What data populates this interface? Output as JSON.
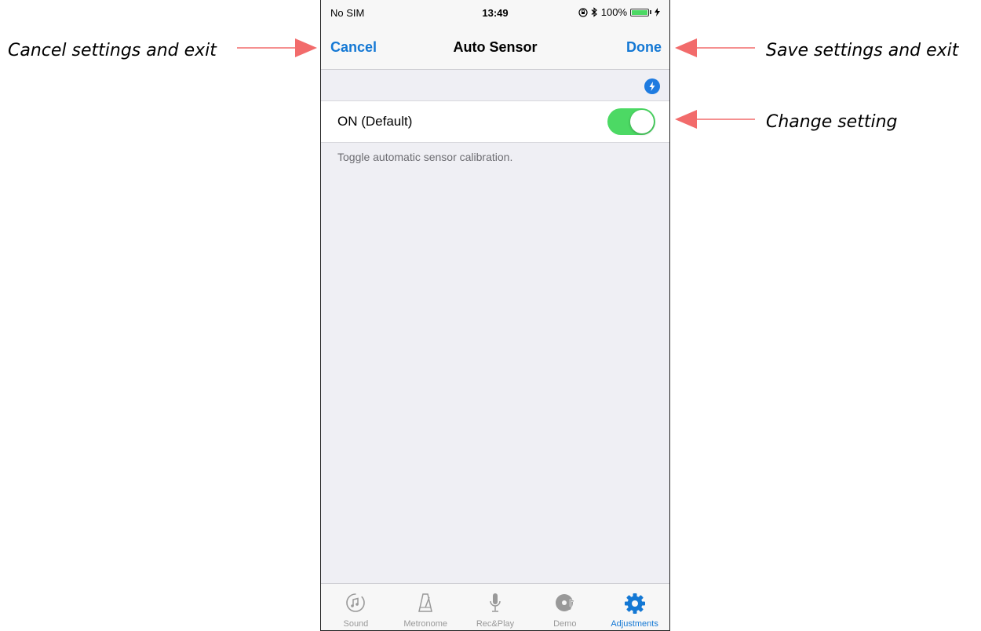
{
  "status_bar": {
    "carrier": "No SIM",
    "time": "13:49",
    "battery": "100%",
    "icons": [
      "orientation-lock-icon",
      "bluetooth-icon",
      "battery-icon",
      "charging-bolt-icon"
    ]
  },
  "nav_bar": {
    "cancel_label": "Cancel",
    "title": "Auto Sensor",
    "done_label": "Done"
  },
  "setting": {
    "label": "ON (Default)",
    "toggle_on": true,
    "description": "Toggle automatic sensor calibration."
  },
  "tab_bar": {
    "items": [
      {
        "label": "Sound",
        "icon": "sound-icon",
        "active": false
      },
      {
        "label": "Metronome",
        "icon": "metronome-icon",
        "active": false
      },
      {
        "label": "Rec&Play",
        "icon": "microphone-icon",
        "active": false
      },
      {
        "label": "Demo",
        "icon": "disc-icon",
        "active": false
      },
      {
        "label": "Adjustments",
        "icon": "gear-icon",
        "active": true
      }
    ]
  },
  "annotations": {
    "cancel": "Cancel settings and exit",
    "done": "Save settings and exit",
    "toggle": "Change setting"
  },
  "colors": {
    "accent": "#1478d4",
    "toggle_on": "#4cd964",
    "arrow": "#f26b6b"
  }
}
